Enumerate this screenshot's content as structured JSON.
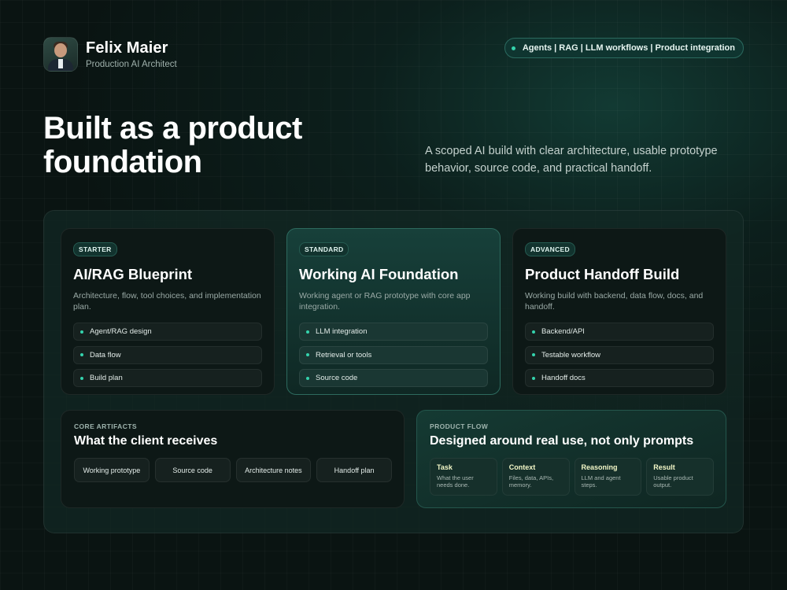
{
  "profile": {
    "name": "Felix Maier",
    "role": "Production AI Architect"
  },
  "tagline": "Agents | RAG | LLM workflows | Product integration",
  "hero": {
    "title": "Built as a product foundation",
    "description": "A scoped AI build with clear architecture, usable prototype behavior, source code, and practical handoff."
  },
  "tiers": [
    {
      "badge": "STARTER",
      "title": "AI/RAG Blueprint",
      "description": "Architecture, flow, tool choices, and implementation plan.",
      "features": [
        "Agent/RAG design",
        "Data flow",
        "Build plan"
      ]
    },
    {
      "badge": "STANDARD",
      "title": "Working AI Foundation",
      "description": "Working agent or RAG prototype with core app integration.",
      "features": [
        "LLM integration",
        "Retrieval or tools",
        "Source code"
      ]
    },
    {
      "badge": "ADVANCED",
      "title": "Product Handoff Build",
      "description": "Working build with backend, data flow, docs, and handoff.",
      "features": [
        "Backend/API",
        "Testable workflow",
        "Handoff docs"
      ]
    }
  ],
  "artifacts": {
    "label": "CORE ARTIFACTS",
    "title": "What the client receives",
    "items": [
      "Working prototype",
      "Source code",
      "Architecture notes",
      "Handoff plan"
    ]
  },
  "flow": {
    "label": "PRODUCT FLOW",
    "title": "Designed around real use, not only prompts",
    "steps": [
      {
        "title": "Task",
        "description": "What the user needs done."
      },
      {
        "title": "Context",
        "description": "Files, data, APIs, memory."
      },
      {
        "title": "Reasoning",
        "description": "LLM and agent steps."
      },
      {
        "title": "Result",
        "description": "Usable product output."
      }
    ]
  },
  "colors": {
    "accent": "#34d3ad",
    "background": "#0c1f1c",
    "step_title": "#f4f8c8"
  },
  "icons": {
    "avatar": "profile-photo",
    "bullet": "dot-icon"
  }
}
